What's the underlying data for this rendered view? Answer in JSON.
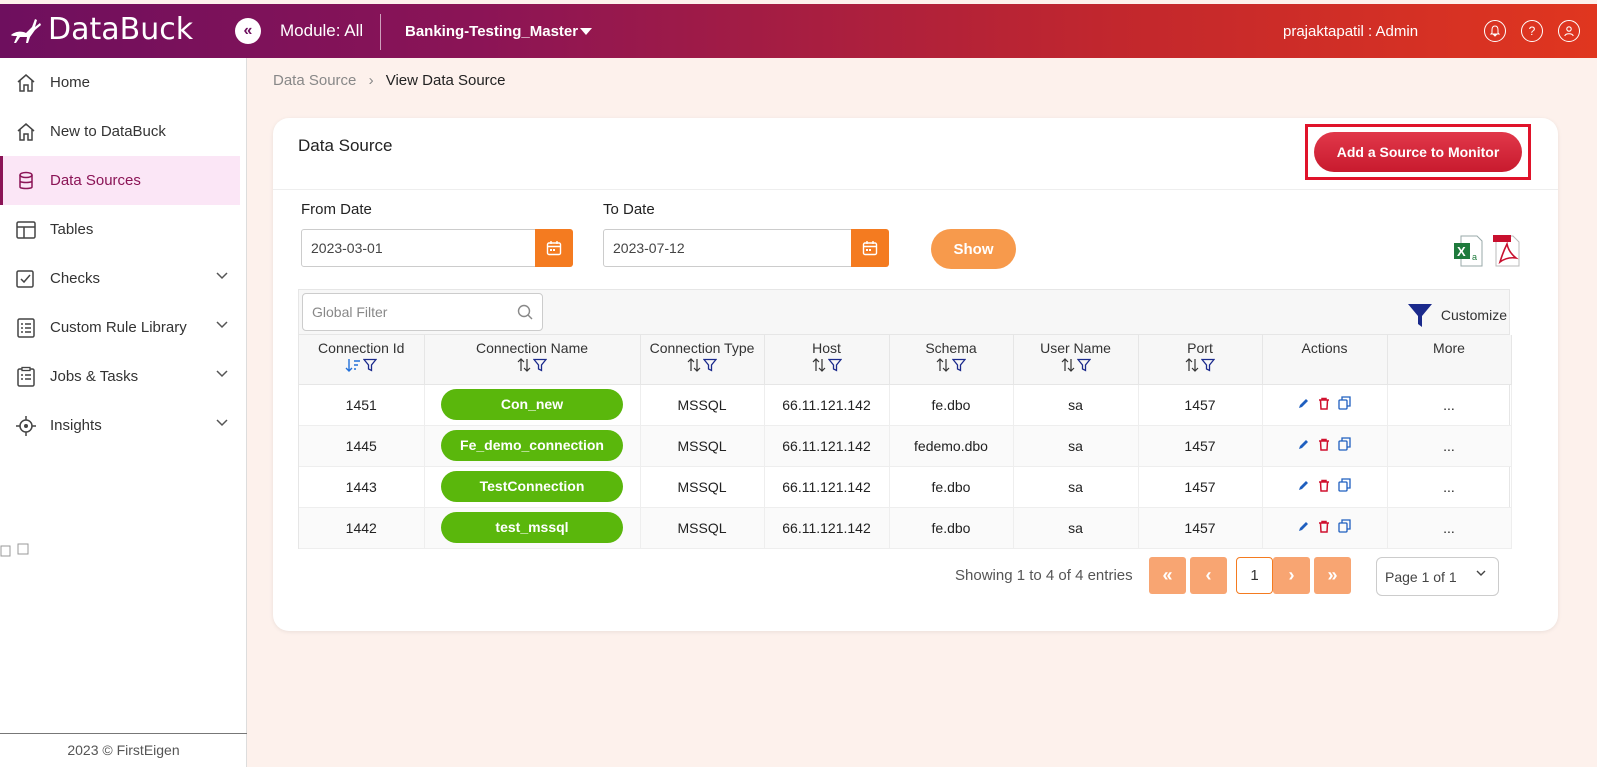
{
  "brand": {
    "name": "DataBuck"
  },
  "header": {
    "module": "Module: All",
    "project": "Banking-Testing_Master",
    "user": "prajaktapatil : Admin"
  },
  "sidebar": {
    "items": [
      {
        "label": "Home",
        "icon": "home-icon"
      },
      {
        "label": "New to DataBuck",
        "icon": "home-icon"
      },
      {
        "label": "Data Sources",
        "icon": "database-icon",
        "active": true
      },
      {
        "label": "Tables",
        "icon": "table-icon"
      },
      {
        "label": "Checks",
        "icon": "checks-icon",
        "expandable": true
      },
      {
        "label": "Custom Rule Library",
        "icon": "rule-library-icon",
        "expandable": true
      },
      {
        "label": "Jobs & Tasks",
        "icon": "jobs-icon",
        "expandable": true
      },
      {
        "label": "Insights",
        "icon": "insights-icon",
        "expandable": true
      }
    ],
    "footer": "2023 © FirstEigen"
  },
  "breadcrumb": {
    "parent": "Data Source",
    "current": "View Data Source"
  },
  "card": {
    "title": "Data Source",
    "add_button": "Add a Source to Monitor",
    "from_label": "From Date",
    "from_value": "2023-03-01",
    "to_label": "To Date",
    "to_value": "2023-07-12",
    "show_button": "Show",
    "global_filter_placeholder": "Global Filter",
    "customize": "Customize"
  },
  "table": {
    "columns": [
      "Connection Id",
      "Connection Name",
      "Connection Type",
      "Host",
      "Schema",
      "User Name",
      "Port",
      "Actions",
      "More"
    ],
    "rows": [
      {
        "id": "1451",
        "name": "Con_new",
        "type": "MSSQL",
        "host": "66.11.121.142",
        "schema": "fe.dbo",
        "user": "sa",
        "port": "1457",
        "more": "..."
      },
      {
        "id": "1445",
        "name": "Fe_demo_connection",
        "type": "MSSQL",
        "host": "66.11.121.142",
        "schema": "fedemo.dbo",
        "user": "sa",
        "port": "1457",
        "more": "..."
      },
      {
        "id": "1443",
        "name": "TestConnection",
        "type": "MSSQL",
        "host": "66.11.121.142",
        "schema": "fe.dbo",
        "user": "sa",
        "port": "1457",
        "more": "..."
      },
      {
        "id": "1442",
        "name": "test_mssql",
        "type": "MSSQL",
        "host": "66.11.121.142",
        "schema": "fe.dbo",
        "user": "sa",
        "port": "1457",
        "more": "..."
      }
    ]
  },
  "pager": {
    "summary": "Showing 1 to 4 of 4 entries",
    "current": "1",
    "page_select": "Page 1 of 1"
  },
  "colors": {
    "accent": "#f47b20",
    "brand": "#8b1456",
    "pill": "#5ab70c",
    "add": "#d3223a"
  }
}
